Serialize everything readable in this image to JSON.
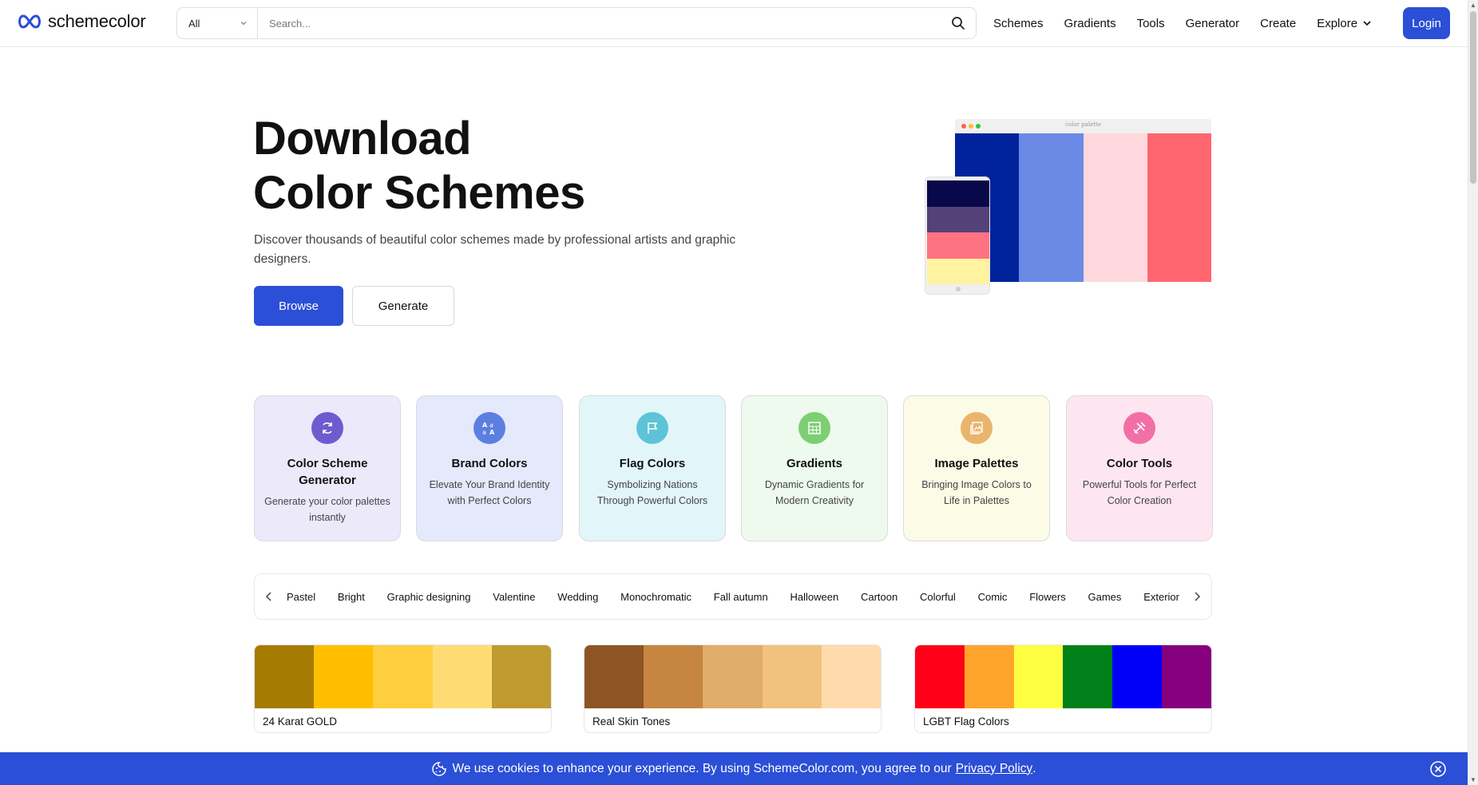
{
  "header": {
    "logo_text": "schemecolor",
    "search": {
      "category": "All",
      "placeholder": "Search..."
    },
    "nav": [
      "Schemes",
      "Gradients",
      "Tools",
      "Generator",
      "Create",
      "Explore"
    ],
    "login_label": "Login"
  },
  "hero": {
    "title_line1": "Download",
    "title_line2": "Color Schemes",
    "description": "Discover thousands of beautiful color schemes made by professional artists and graphic designers.",
    "browse_label": "Browse",
    "generate_label": "Generate",
    "illustration": {
      "caption": "color palette",
      "window_colors": [
        "#00239c",
        "#6b8ae6",
        "#ffd8de",
        "#ff6670"
      ],
      "phone_colors": [
        "#08084a",
        "#544177",
        "#ff7283",
        "#fff3a1"
      ],
      "dot_colors": [
        "#ff5f57",
        "#febc2e",
        "#28c840"
      ]
    }
  },
  "categories": [
    {
      "title": "Color Scheme Generator",
      "desc": "Generate your color palettes instantly",
      "icon": "refresh-icon",
      "bg": "#ece9fb",
      "icon_bg": "#6e5bcf"
    },
    {
      "title": "Brand Colors",
      "desc": "Elevate Your Brand Identity with Perfect Colors",
      "icon": "brand-letters-icon",
      "bg": "#e4e9fb",
      "icon_bg": "#5b7fe0"
    },
    {
      "title": "Flag Colors",
      "desc": "Symbolizing Nations Through Powerful Colors",
      "icon": "flag-icon",
      "bg": "#e2f6fa",
      "icon_bg": "#5cc4d6"
    },
    {
      "title": "Gradients",
      "desc": "Dynamic Gradients for Modern Creativity",
      "icon": "gradient-grid-icon",
      "bg": "#eefaee",
      "icon_bg": "#7dcf73"
    },
    {
      "title": "Image Palettes",
      "desc": "Bringing Image Colors to Life in Palettes",
      "icon": "image-gallery-icon",
      "bg": "#fcfbe6",
      "icon_bg": "#e9b46c"
    },
    {
      "title": "Color Tools",
      "desc": "Powerful Tools for Perfect Color Creation",
      "icon": "tools-icon",
      "bg": "#fde6f0",
      "icon_bg": "#f26fa6"
    }
  ],
  "tags": [
    "Pastel",
    "Bright",
    "Graphic designing",
    "Valentine",
    "Wedding",
    "Monochromatic",
    "Fall autumn",
    "Halloween",
    "Cartoon",
    "Colorful",
    "Comic",
    "Flowers",
    "Games",
    "Exterior"
  ],
  "palettes": [
    {
      "name": "24 Karat GOLD",
      "colors": [
        "#a67c00",
        "#ffbf00",
        "#ffcf40",
        "#ffdc73",
        "#bf9b30"
      ]
    },
    {
      "name": "Real Skin Tones",
      "colors": [
        "#8d5524",
        "#c68642",
        "#e0ac69",
        "#f1c27d",
        "#ffdbac"
      ]
    },
    {
      "name": "LGBT Flag Colors",
      "colors": [
        "#ff0018",
        "#ffa52c",
        "#ffff41",
        "#008018",
        "#0000f9",
        "#86007d"
      ]
    }
  ],
  "cookie": {
    "text": "We use cookies to enhance your experience. By using SchemeColor.com, you agree to our",
    "link_label": "Privacy Policy",
    "suffix": "."
  },
  "colors": {
    "accent": "#2b4fd6"
  }
}
